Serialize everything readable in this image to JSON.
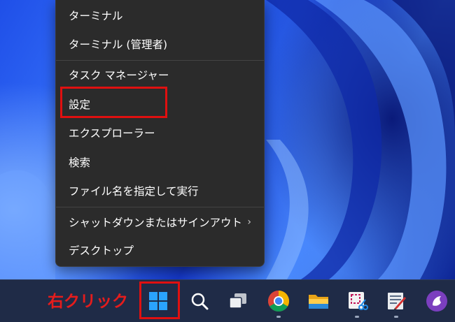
{
  "context_menu": {
    "items": [
      {
        "label": "ターミナル"
      },
      {
        "label": "ターミナル (管理者)"
      },
      {
        "label": "タスク マネージャー"
      },
      {
        "label": "設定"
      },
      {
        "label": "エクスプローラー"
      },
      {
        "label": "検索"
      },
      {
        "label": "ファイル名を指定して実行"
      },
      {
        "label": "シャットダウンまたはサインアウト",
        "submenu_indicator": "›"
      },
      {
        "label": "デスクトップ"
      }
    ]
  },
  "annotation": {
    "text": "右クリック",
    "color": "#e51c1c"
  },
  "taskbar": {
    "icons": [
      "start-icon",
      "search-icon",
      "task-view-icon",
      "chrome-icon",
      "file-explorer-icon",
      "snipping-tool-icon",
      "paint-icon",
      "app-icon"
    ]
  },
  "colors": {
    "menu_bg": "#2b2b2b",
    "taskbar_bg": "#1f2b47",
    "highlight": "#e01010",
    "windows_blue": "#0078d4"
  }
}
